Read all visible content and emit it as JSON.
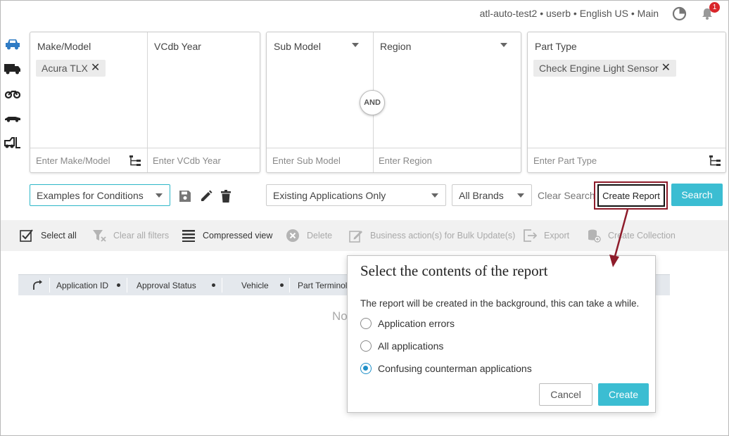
{
  "header": {
    "user_info": "atl-auto-test2 • userb • English US • Main",
    "notification_count": "1"
  },
  "vehicle_types": [
    "car-icon",
    "truck-icon",
    "motorcycle-icon",
    "race-car-icon",
    "forklift-icon"
  ],
  "filters": {
    "make_model": {
      "label": "Make/Model",
      "chip": "Acura TLX",
      "placeholder": "Enter Make/Model"
    },
    "vcdb_year": {
      "label": "VCdb Year",
      "placeholder": "Enter VCdb Year"
    },
    "sub_model": {
      "label": "Sub Model",
      "placeholder": "Enter Sub Model"
    },
    "region": {
      "label": "Region",
      "placeholder": "Enter Region"
    },
    "and_label": "AND",
    "part_type": {
      "label": "Part Type",
      "chip": "Check Engine Light Sensor",
      "placeholder": "Enter Part Type"
    }
  },
  "controls": {
    "conditions_select": "Examples for Conditions",
    "applications_select": "Existing Applications Only",
    "brands_select": "All Brands",
    "clear_search": "Clear Search",
    "create_report": "Create Report",
    "search": "Search"
  },
  "toolbar": {
    "select_all": "Select all",
    "clear_filters": "Clear all filters",
    "compressed_view": "Compressed view",
    "delete": "Delete",
    "business_action": "Business action(s) for Bulk Update(s)",
    "export": "Export",
    "create_collection": "Create Collection"
  },
  "grid": {
    "columns": [
      "Application ID",
      "Approval Status",
      "Vehicle",
      "Part Terminol"
    ],
    "empty_text": "No"
  },
  "modal": {
    "title": "Select the contents of the report",
    "description": "The report will be created in the background, this can take a while.",
    "options": [
      {
        "label": "Application errors",
        "checked": false
      },
      {
        "label": "All applications",
        "checked": false
      },
      {
        "label": "Confusing counterman applications",
        "checked": true
      }
    ],
    "cancel": "Cancel",
    "create": "Create"
  },
  "colors": {
    "accent": "#3bbdd2",
    "highlight": "#8e1c2b",
    "radio_selected": "#1f8fc8",
    "badge": "#d9262b"
  }
}
